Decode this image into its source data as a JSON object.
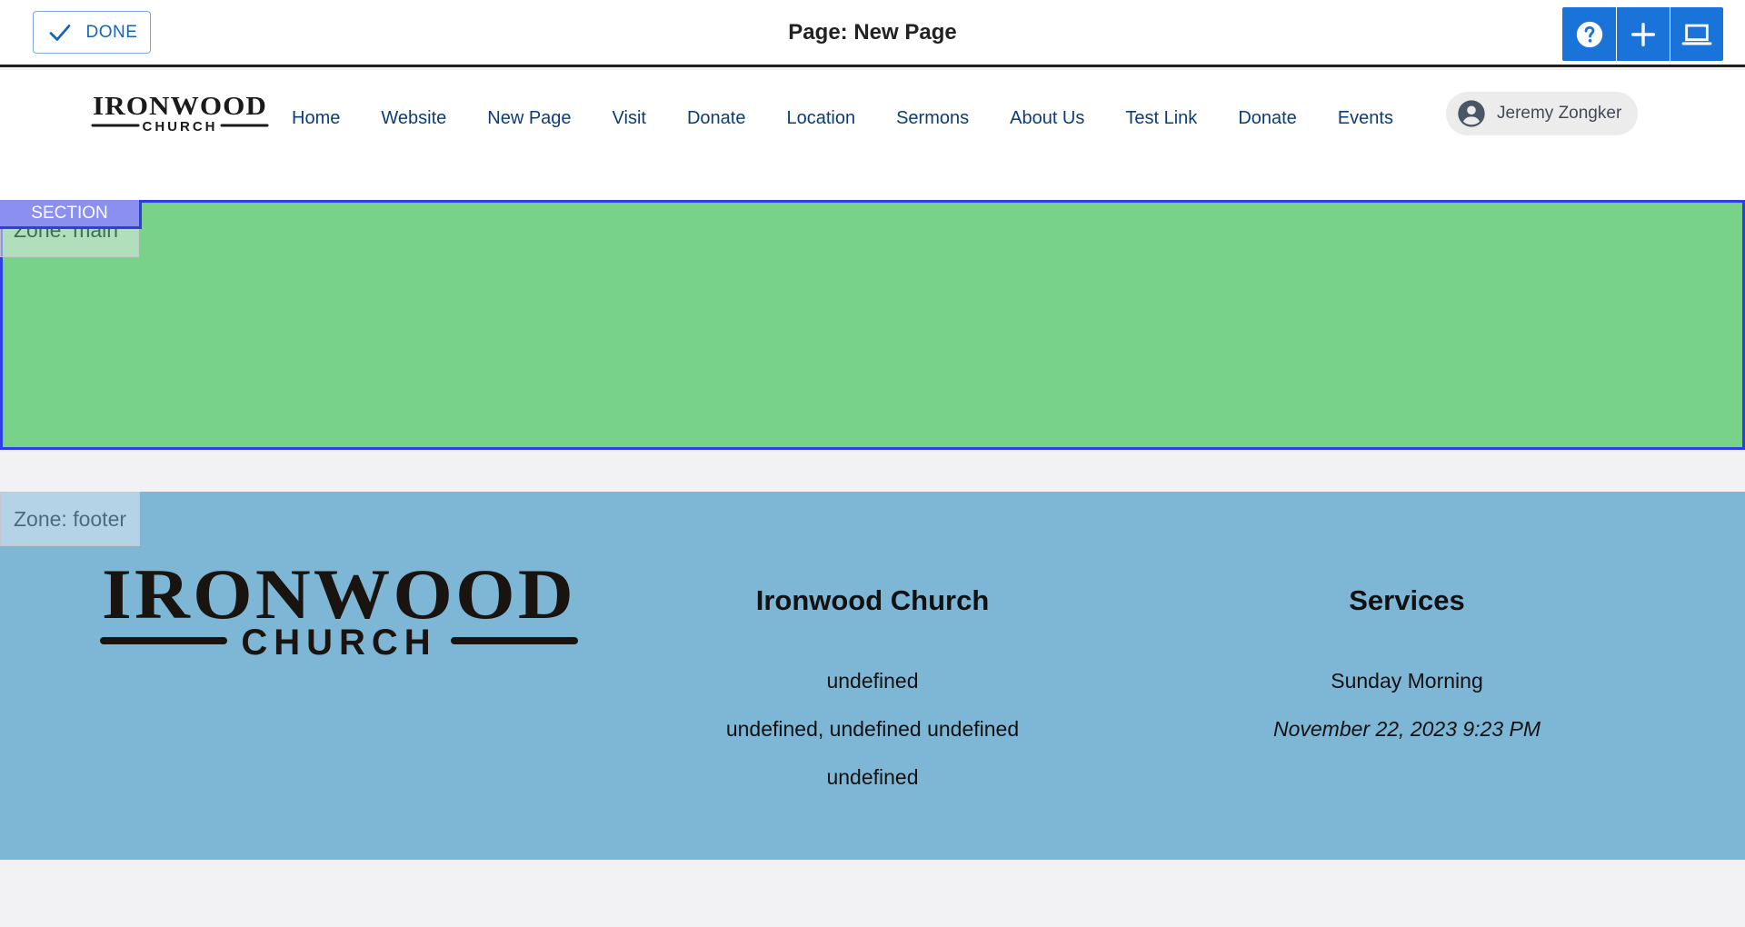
{
  "editor": {
    "done_label": "DONE",
    "page_title": "Page: New Page",
    "tools": [
      "help-icon",
      "add-icon",
      "laptop-icon"
    ]
  },
  "nav": {
    "logo_text": {
      "line1": "IRONWOOD",
      "line2": "CHURCH"
    },
    "links": [
      "Home",
      "Website",
      "New Page",
      "Visit",
      "Donate",
      "Location",
      "Sermons",
      "About Us",
      "Test Link",
      "Donate",
      "Events"
    ],
    "user_name": "Jeremy Zongker"
  },
  "main_zone": {
    "section_label": "SECTION",
    "zone_label": "Zone: main"
  },
  "footer_zone": {
    "zone_label": "Zone: footer",
    "logo_text": {
      "line1": "IRONWOOD",
      "line2": "CHURCH"
    },
    "church": {
      "heading": "Ironwood Church",
      "lines": [
        "undefined",
        "undefined, undefined undefined",
        "undefined"
      ]
    },
    "services": {
      "heading": "Services",
      "service_name": "Sunday Morning",
      "datetime": "November 22, 2023 9:23 PM"
    }
  },
  "colors": {
    "accent": "#1a73d9",
    "nav_link": "#0d3c7a",
    "main_zone_bg": "#78d28a",
    "main_zone_border": "#2f3de6",
    "footer_bg": "#7eb6d6"
  }
}
